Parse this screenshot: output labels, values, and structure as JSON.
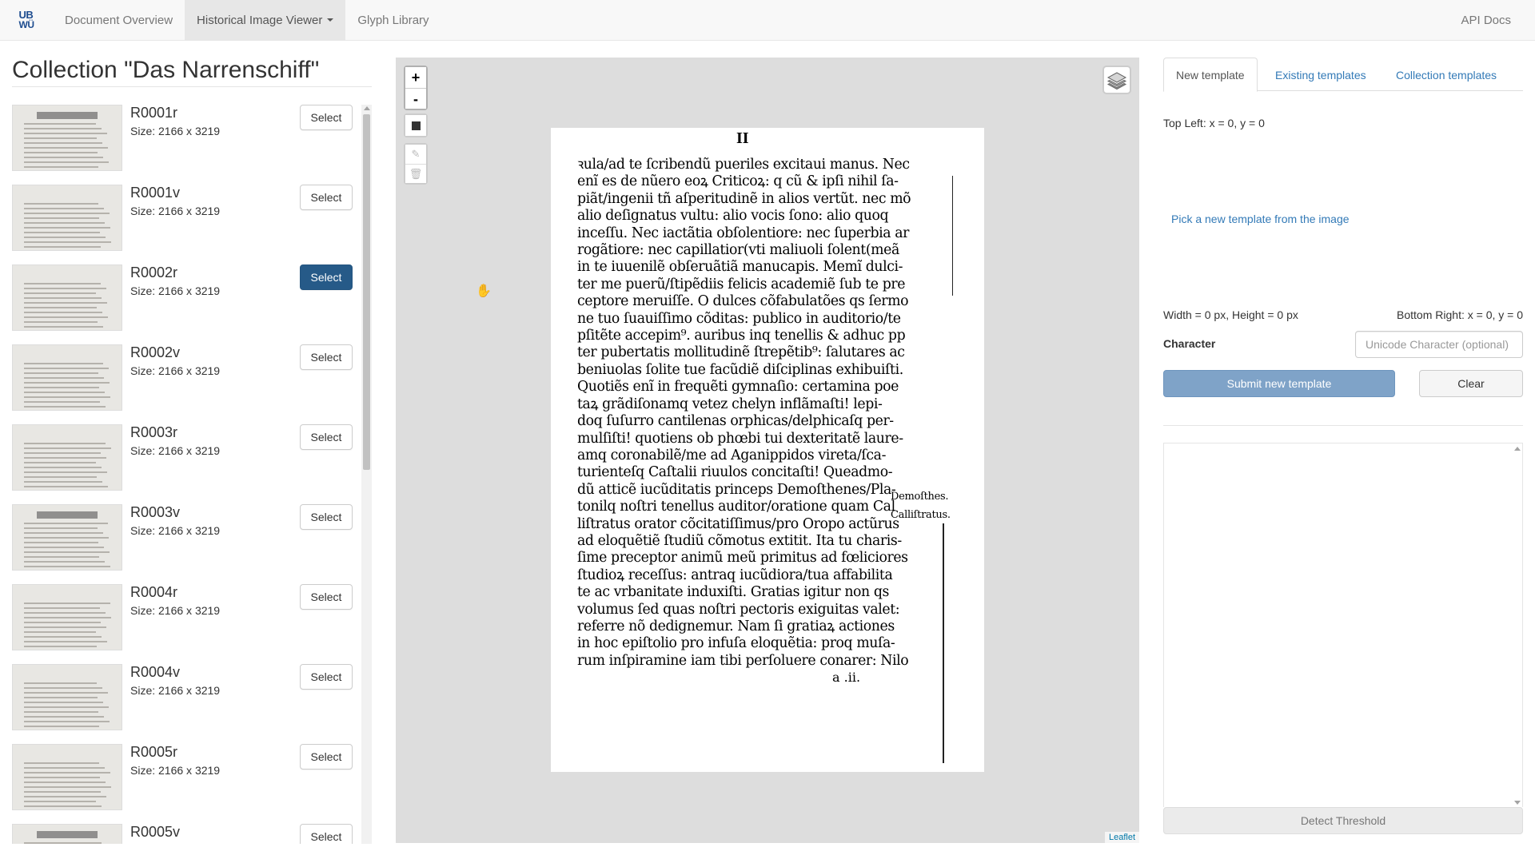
{
  "navbar": {
    "logo_line1": "UB",
    "logo_line2": "WÜ",
    "items": [
      {
        "label": "Document Overview"
      },
      {
        "label": "Historical Image Viewer"
      },
      {
        "label": "Glyph Library"
      }
    ],
    "right_label": "API Docs"
  },
  "collection": {
    "title": "Collection \"Das Narrenschiff\"",
    "select_label": "Select",
    "items": [
      {
        "name": "R0001r",
        "size": "Size: 2166 x 3219",
        "selected": false
      },
      {
        "name": "R0001v",
        "size": "Size: 2166 x 3219",
        "selected": false
      },
      {
        "name": "R0002r",
        "size": "Size: 2166 x 3219",
        "selected": true
      },
      {
        "name": "R0002v",
        "size": "Size: 2166 x 3219",
        "selected": false
      },
      {
        "name": "R0003r",
        "size": "Size: 2166 x 3219",
        "selected": false
      },
      {
        "name": "R0003v",
        "size": "Size: 2166 x 3219",
        "selected": false
      },
      {
        "name": "R0004r",
        "size": "Size: 2166 x 3219",
        "selected": false
      },
      {
        "name": "R0004v",
        "size": "Size: 2166 x 3219",
        "selected": false
      },
      {
        "name": "R0005r",
        "size": "Size: 2166 x 3219",
        "selected": false
      },
      {
        "name": "R0005v",
        "size": "",
        "selected": false
      }
    ]
  },
  "map": {
    "zoom_in": "+",
    "zoom_out": "-",
    "attribution": "Leaflet",
    "page": {
      "page_number": "II",
      "lines": [
        "ꝛula/ad te ſcribendũ pueriles excitaui manus. Nec",
        "enĩ es de nũero eoꝝ Criticoꝝ: q cũ & ipſi nihil ſa-",
        "piãt/ingenii tñ aſperitudinẽ in alios vertũt. nec mõ",
        "alio deſignatus vultu: alio vocis ſono: alio quoq",
        "inceſſu. Nec iactãtia obſolentiore: nec ſuperbia ar",
        "rogãtiore: nec capillatior(vti maliuoli ſolent(meã",
        "in te iuuenilẽ obſeruãtiã manucapis. Memĩ dulci-",
        "ter me puerũ/ſtipẽdiis felicis academiẽ ſub te pre",
        "ceptore meruiſſe. O dulces cõfabulatões qs ſermo",
        "ne tuo ſuauiſſimo cõditas: publico in auditorio/te",
        "pſitẽte accepim⁹. auribus inq tenellis & adhuc pp",
        "ter pubertatis mollitudinẽ ſtrepẽtib⁹: ſalutares ac",
        "beniuolas ſolite tue facũdiẽ diſciplinas exhibuiſti.",
        "Quotiẽs enĩ in frequẽti gymnaſio: certamina poe",
        "taꝝ grãdiſonamq vetez chelyn inflãmaſti! lepi-",
        "doq ſuſurro cantilenas orphicas/delphicaſq per-",
        "mulſiſti! quotiens ob phœbi tui dexteritatẽ laure-",
        "amq coronabilẽ/me ad Aganippidos vireta/ſca-",
        "turienteſq Caſtalii riuulos concitaſti! Queadmo-",
        "dũ atticẽ iucũditatis princeps Demoſthenes/Pla-",
        "tonilq noſtri tenellus auditor/oratione quam Cal",
        "liſtratus orator cõcitatiſſimus/pro Oropo actũrus",
        "ad eloquẽtiẽ ſtudiũ cõmotus extitit. Ita tu charis-",
        "ſime preceptor animũ meũ primitus ad fœliciores",
        "ſtudioꝝ receſſus: antraq iucũdiora/tua affabilita",
        "te ac vrbanitate induxiſti. Gratias igitur non qs",
        "volumus ſed quas noſtri pectoris exiguitas valet:",
        "referre nõ dedignemur. Nam ſi gratiaꝝ actiones",
        "in hoc epiſtolio pro infuſa eloquẽtia: proq muſa-",
        "rum inſpiramine iam tibi perſoluere conarer: Nilo"
      ],
      "margin_notes": [
        "Demoſthes.",
        "Calliſtratus."
      ],
      "folio": "a .ii."
    }
  },
  "template_panel": {
    "tabs": [
      {
        "label": "New template"
      },
      {
        "label": "Existing templates"
      },
      {
        "label": "Collection templates"
      }
    ],
    "top_left": "Top Left: x = 0, y = 0",
    "pick_link": "Pick a new template from the image",
    "dimensions": "Width = 0 px, Height = 0 px",
    "bottom_right": "Bottom Right: x = 0, y = 0",
    "character_label": "Character",
    "character_placeholder": "Unicode Character (optional)",
    "submit_label": "Submit new template",
    "clear_label": "Clear",
    "detect_label": "Detect Threshold"
  },
  "colors": {
    "primary": "#265a88",
    "link": "#337ab7",
    "submit_disabled": "#7fa3c8",
    "map_bg": "#dddddd"
  }
}
